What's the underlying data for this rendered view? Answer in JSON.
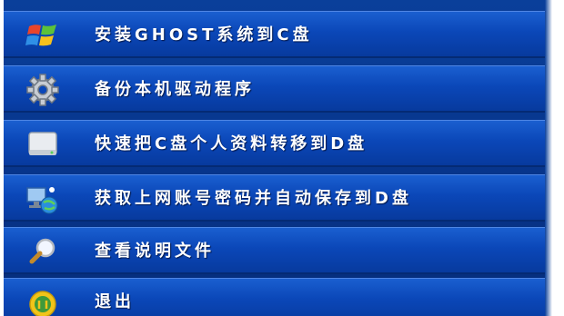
{
  "menu": {
    "items": [
      {
        "label": "安装GHOST系统到C盘",
        "icon": "windows-logo-icon"
      },
      {
        "label": "备份本机驱动程序",
        "icon": "gear-icon"
      },
      {
        "label": "快速把C盘个人资料转移到D盘",
        "icon": "drive-icon"
      },
      {
        "label": "获取上网账号密码并自动保存到D盘",
        "icon": "network-computer-icon"
      },
      {
        "label": "查看说明文件",
        "icon": "magnifier-icon"
      },
      {
        "label": "退出",
        "icon": "exit-icon"
      }
    ]
  },
  "colors": {
    "item_gradient_top": "#1a5fd0",
    "item_gradient_bottom": "#073a9e",
    "label": "#ffffff"
  }
}
